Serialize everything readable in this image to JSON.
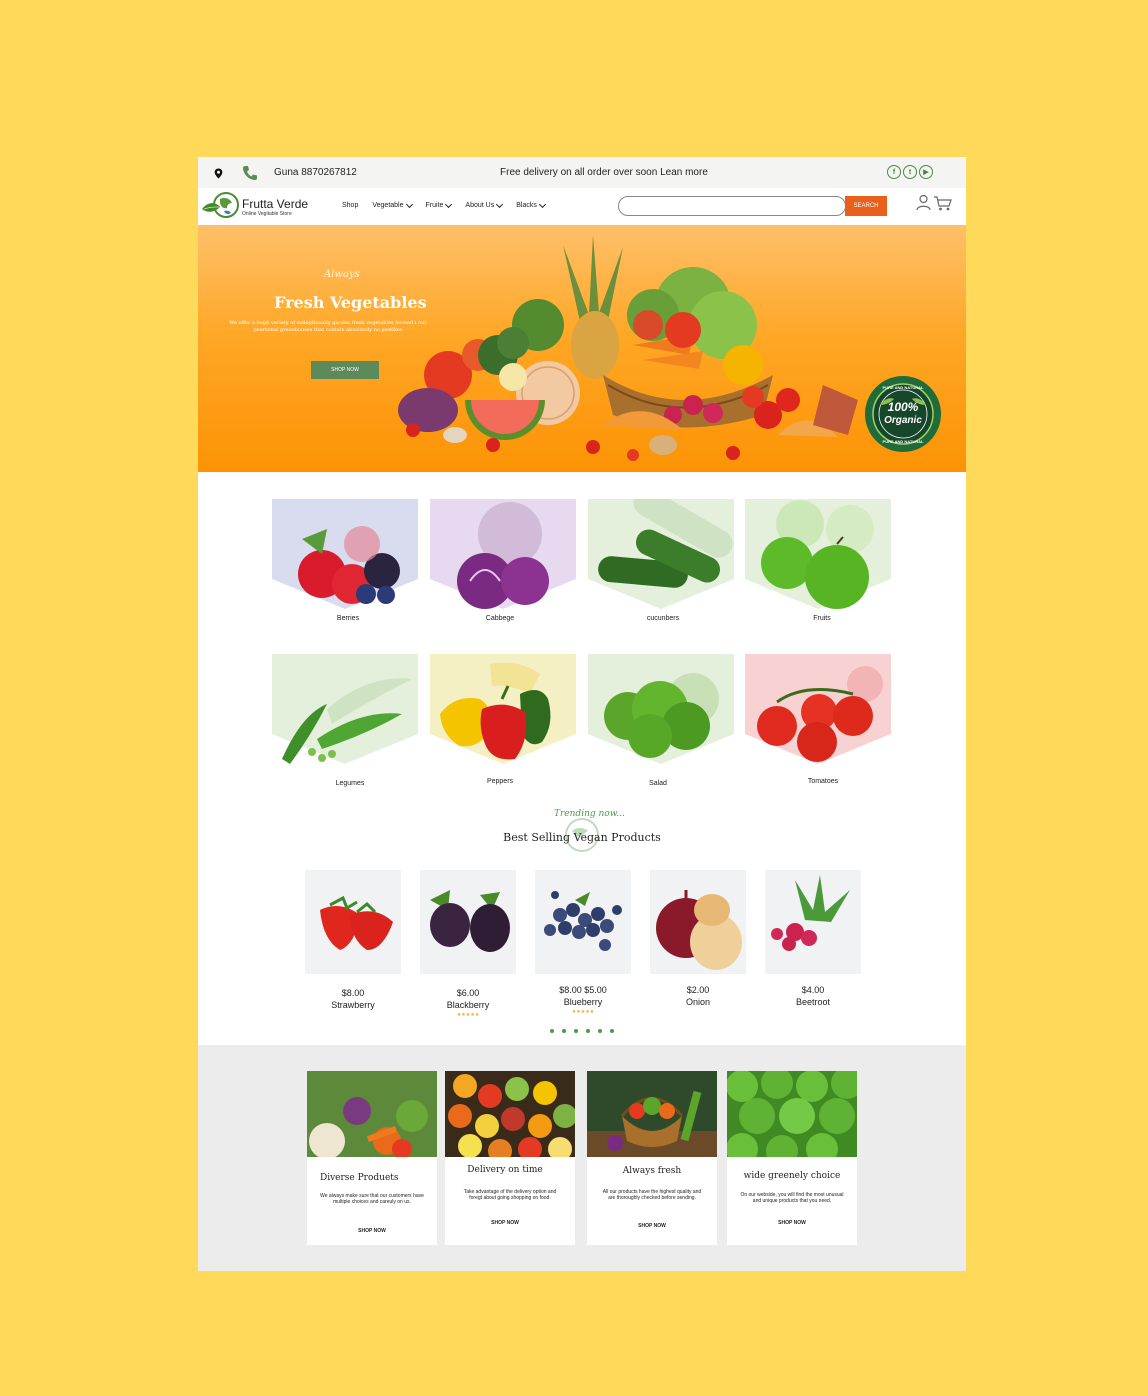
{
  "topbar": {
    "phone": "Guna 8870267812",
    "promo": "Free delivery on all order over soon Lean more",
    "social": [
      "f",
      "t",
      "▶"
    ]
  },
  "nav": {
    "brand": "Frutta Verde",
    "tagline": "Online Vegitable Store",
    "menu": [
      "Shop",
      "Vegetable",
      "Fruite",
      "About Us",
      "Blacks"
    ],
    "search_placeholder": "",
    "search_button": "SEARCH"
  },
  "hero": {
    "script": "Always",
    "title": "Fresh Vegetables",
    "description": "We offer a hugh veriety of exdeptionally garden fresh vegetables formed i our  pearsonal greenhouses that contain absolutely no pestikes",
    "cta": "SHOP NOW",
    "badge_top": "PURE AND NATURAL",
    "badge_main": "100%",
    "badge_sub": "Organic",
    "badge_bottom": "PURE AND NATURAL"
  },
  "categories": [
    {
      "label": "Berries",
      "bg": "#d9dcef"
    },
    {
      "label": "Cabbege",
      "bg": "#e7d9f0"
    },
    {
      "label": "cucunbers",
      "bg": "#e4f0dc"
    },
    {
      "label": "Fruits",
      "bg": "#e4f0dc"
    },
    {
      "label": "Legumes",
      "bg": "#e4f0dc"
    },
    {
      "label": "Peppers",
      "bg": "#f5f0c4"
    },
    {
      "label": "Salad",
      "bg": "#e4f0dc"
    },
    {
      "label": "Tomatoes",
      "bg": "#f8d2d2"
    }
  ],
  "best_selling": {
    "script": "Trending now...",
    "title": "Best Selling Vegan Products",
    "products": [
      {
        "price": "$8.00",
        "name": "Strawberry",
        "stars": ""
      },
      {
        "price": "$6.00",
        "name": "Blackberry",
        "stars": "★★★★★"
      },
      {
        "price": "$8.00 $5.00",
        "name": "Blueberry",
        "stars": "★★★★★"
      },
      {
        "price": "$2.00",
        "name": "Onion",
        "stars": ""
      },
      {
        "price": "$4.00",
        "name": "Beetroot",
        "stars": ""
      }
    ]
  },
  "features": [
    {
      "title": "Diverse Produets",
      "desc": "We always make sure that our customers have multiple choices and careuly on us.",
      "link": "SHOP NOW"
    },
    {
      "title": "Delivery on time",
      "desc": "Take advantage of the delivery option and foregt about going shopping on food.",
      "link": "SHOP NOW"
    },
    {
      "title": "Always fresh",
      "desc": "All our products have the highest quality and are thoroughly checked before sending.",
      "link": "SHOP NOW"
    },
    {
      "title": "wide greenely choice",
      "desc": "On our webside, you will find the most unusual and unique products that you need.",
      "link": "SHOP NOW"
    }
  ]
}
